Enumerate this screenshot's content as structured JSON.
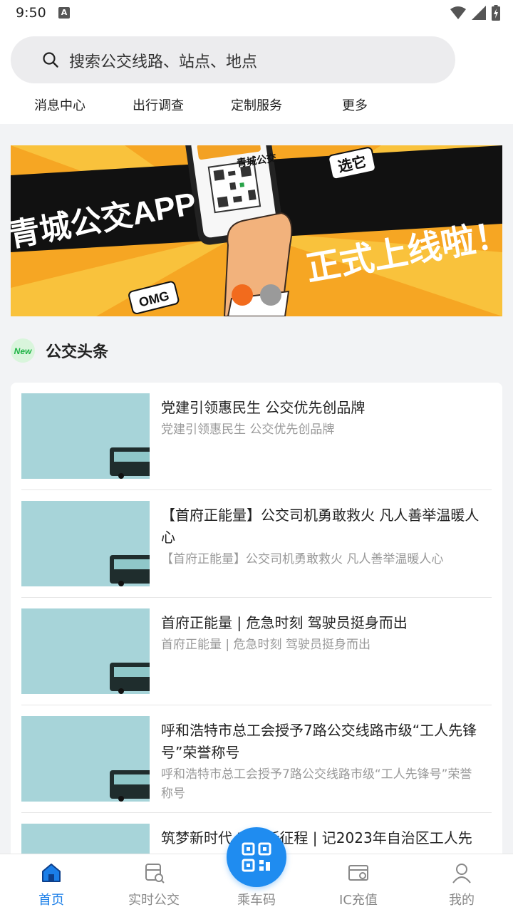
{
  "status_bar": {
    "time": "9:50"
  },
  "search": {
    "placeholder": "搜索公交线路、站点、地点"
  },
  "quick_nav": [
    {
      "label": "消息中心"
    },
    {
      "label": "出行调查"
    },
    {
      "label": "定制服务"
    },
    {
      "label": "更多"
    }
  ],
  "banner": {
    "headline": "青城公交APP",
    "tagline": "正式上线啦！",
    "badge_left": "OMG",
    "badge_right": "选它",
    "phone_label": "青城公交",
    "active_slide": 1,
    "slide_count": 2,
    "colors": {
      "dot_active": "#f26b1d",
      "dot_inactive": "#9a9a9a"
    }
  },
  "news_section": {
    "title": "公交头条",
    "badge": "New"
  },
  "news": [
    {
      "title": "党建引领惠民生 公交优先创品牌",
      "summary": "党建引领惠民生 公交优先创品牌"
    },
    {
      "title": "【首府正能量】公交司机勇敢救火 凡人善举温暖人心",
      "summary": "【首府正能量】公交司机勇敢救火 凡人善举温暖人心"
    },
    {
      "title": "首府正能量 | 危急时刻 驾驶员挺身而出",
      "summary": "首府正能量 | 危急时刻 驾驶员挺身而出"
    },
    {
      "title": "呼和浩特市总工会授予7路公交线路市级“工人先锋号”荣誉称号",
      "summary": "呼和浩特市总工会授予7路公交线路市级“工人先锋号”荣誉称号"
    },
    {
      "title": "筑梦新时代 奋进新征程 | 记2023年自治区工人先",
      "summary": ""
    }
  ],
  "tabbar": [
    {
      "label": "首页",
      "icon": "home-icon",
      "active": true
    },
    {
      "label": "实时公交",
      "icon": "realtime-bus-icon",
      "active": false
    },
    {
      "label": "乘车码",
      "icon": "qr-code-icon",
      "active": false
    },
    {
      "label": "IC充值",
      "icon": "ic-card-icon",
      "active": false
    },
    {
      "label": "我的",
      "icon": "user-icon",
      "active": false
    }
  ],
  "colors": {
    "accent": "#1a7ee8",
    "fab": "#1f8cf0"
  }
}
